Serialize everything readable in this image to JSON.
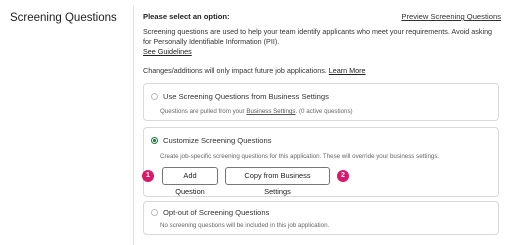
{
  "section_title": "Screening Questions",
  "header": {
    "prompt": "Please select an option:",
    "preview_link": "Preview Screening Questions"
  },
  "description": {
    "text": "Screening questions are used to help your team identify applicants who meet your requirements. Avoid asking for Personally Identifiable Information (PII).",
    "guidelines_link": "See Guidelines"
  },
  "note": {
    "text": "Changes/additions will only impact future job applications.",
    "learn_more": "Learn More"
  },
  "options": [
    {
      "label": "Use Screening Questions from Business Settings",
      "sub_prefix": "Questions are pulled from your",
      "sub_link": "Business Settings",
      "sub_suffix": ". (0 active questions)",
      "selected": false
    },
    {
      "label": "Customize Screening Questions",
      "sub": "Create job-specific screening questions for this application. These will override your business settings.",
      "selected": true
    },
    {
      "label": "Opt-out of Screening Questions",
      "sub": "No screening questions will be included in this job application.",
      "selected": false
    }
  ],
  "buttons": {
    "add_question": "Add Question",
    "copy_from_business": "Copy from Business Settings"
  },
  "badges": {
    "first": "1",
    "second": "2"
  },
  "colors": {
    "accent_green": "#1a7f3c",
    "badge_pink": "#d8196b"
  }
}
